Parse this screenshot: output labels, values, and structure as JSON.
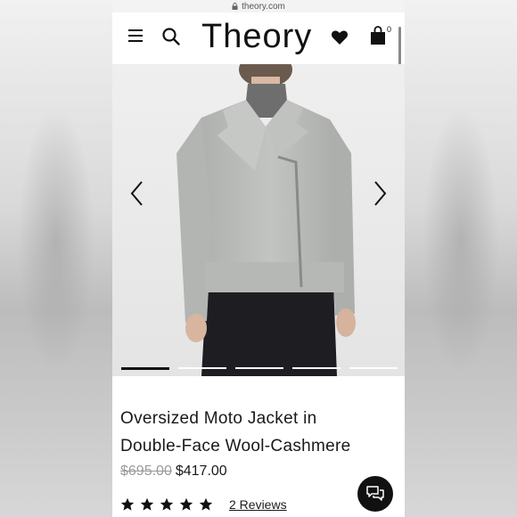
{
  "browser": {
    "url": "theory.com",
    "lock_icon": "lock-icon"
  },
  "header": {
    "logo": "Theory",
    "menu_icon": "hamburger-menu-icon",
    "search_icon": "search-icon",
    "wishlist_icon": "heart-icon",
    "bag_icon": "shopping-bag-icon",
    "bag_count": "0"
  },
  "carousel": {
    "slide_count": 5,
    "active_index": 0,
    "prev_icon": "chevron-left-icon",
    "next_icon": "chevron-right-icon"
  },
  "product": {
    "title_line1": "Oversized Moto Jacket in",
    "title_line2": "Double-Face Wool-Cashmere",
    "original_price": "$695.00",
    "sale_price": "$417.00",
    "rating_stars": 5,
    "reviews_link": "2 Reviews"
  },
  "chat": {
    "icon": "chat-bubbles-icon"
  },
  "colors": {
    "text": "#1a1a1a",
    "strike_price": "#9a9a9a",
    "jacket": "#b9bbb8",
    "chat_bg": "#111111"
  }
}
